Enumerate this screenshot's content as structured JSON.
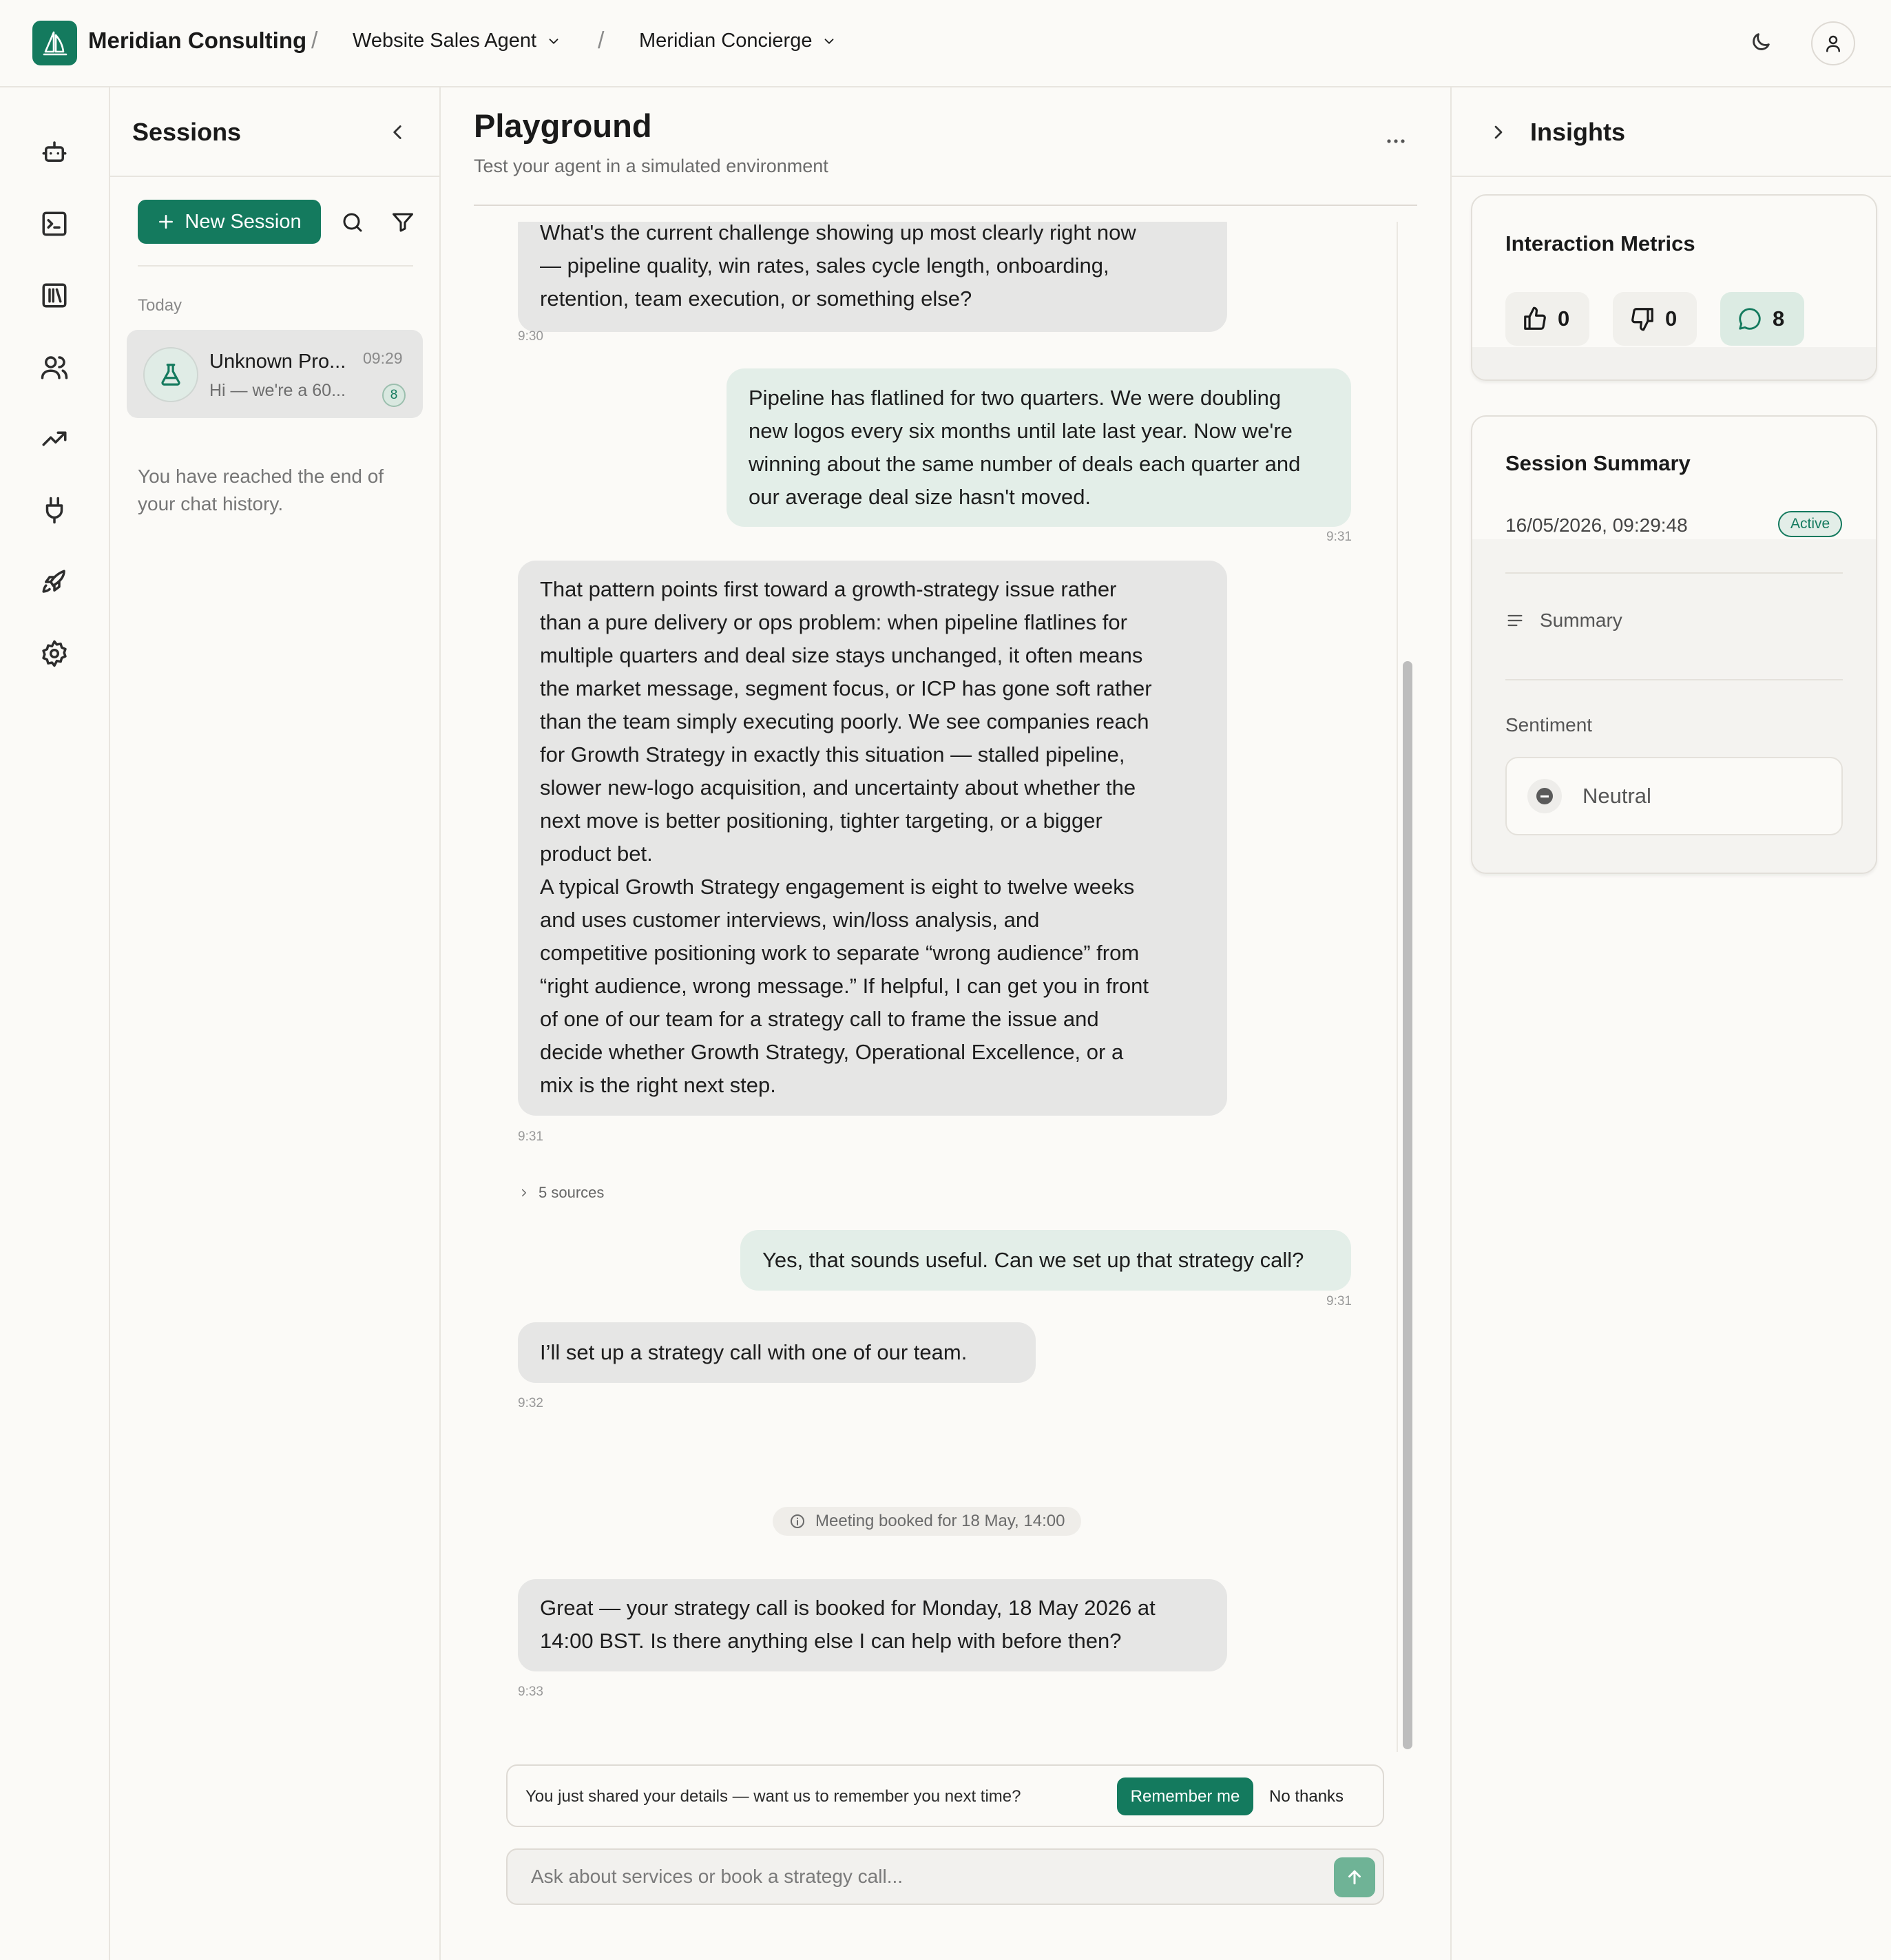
{
  "header": {
    "org_name": "Meridian Consulting",
    "separator": "/",
    "agent_selector": "Website Sales Agent",
    "persona_selector": "Meridian Concierge"
  },
  "rail": {
    "items": [
      "agents-icon",
      "terminal-icon",
      "library-icon",
      "users-icon",
      "analytics-icon",
      "integrations-icon",
      "deploy-icon",
      "settings-icon"
    ]
  },
  "sessions": {
    "title": "Sessions",
    "new_session_label": "New Session",
    "group_label": "Today",
    "items": [
      {
        "name": "Unknown Pro...",
        "time": "09:29",
        "preview": "Hi — we're a 60...",
        "count": "8"
      }
    ],
    "end_text": "You have reached the end of your chat history."
  },
  "playground": {
    "title": "Playground",
    "subtitle": "Test your agent in a simulated environment",
    "messages": [
      {
        "role": "agent",
        "lines": [
          "What's the current challenge showing up most clearly right now",
          "— pipeline quality, win rates, sales cycle length, onboarding,",
          "retention, team execution, or something else?"
        ],
        "time": "9:30"
      },
      {
        "role": "user",
        "lines": [
          "Pipeline has flatlined for two quarters. We were doubling",
          "new logos every six months until late last year. Now we're",
          "winning about the same number of deals each quarter and",
          "our average deal size hasn't moved."
        ],
        "time": "9:31"
      },
      {
        "role": "agent",
        "lines": [
          "That pattern points first toward a growth-strategy issue rather",
          "than a pure delivery or ops problem: when pipeline flatlines for",
          "multiple quarters and deal size stays unchanged, it often means",
          "the market message, segment focus, or ICP has gone soft rather",
          "than the team simply executing poorly. We see companies reach",
          "for Growth Strategy in exactly this situation — stalled pipeline,",
          "slower new-logo acquisition, and uncertainty about whether the",
          "next move is better positioning, tighter targeting, or a bigger",
          "product bet.",
          "A typical Growth Strategy engagement is eight to twelve weeks",
          "and uses customer interviews, win/loss analysis, and",
          "competitive positioning work to separate “wrong audience” from",
          "“right audience, wrong message.” If helpful, I can get you in front",
          "of one of our team for a strategy call to frame the issue and",
          "decide whether Growth Strategy, Operational Excellence, or a",
          "mix is the right next step."
        ],
        "time": "9:31"
      },
      {
        "role": "user",
        "lines": [
          "Yes, that sounds useful. Can we set up that strategy call?"
        ],
        "time": "9:31"
      },
      {
        "role": "agent",
        "lines": [
          "I’ll set up a strategy call with one of our team."
        ],
        "time": "9:32"
      },
      {
        "role": "agent",
        "lines": [
          "Great — your strategy call is booked for Monday, 18 May 2026 at",
          "14:00 BST. Is there anything else I can help with before then?"
        ],
        "time": "9:33"
      }
    ],
    "sources_label": "5 sources",
    "event_label": "Meeting booked for 18 May, 14:00",
    "remember_prompt": "You just shared your details — want us to remember you next time?",
    "remember_label": "Remember me",
    "no_thanks_label": "No thanks",
    "composer_placeholder": "Ask about services or book a strategy call..."
  },
  "insights": {
    "title": "Insights",
    "metrics_title": "Interaction Metrics",
    "likes": "0",
    "dislikes": "0",
    "messages": "8",
    "summary_title": "Session Summary",
    "summary_date": "16/05/2026, 09:29:48",
    "status": "Active",
    "summary_label": "Summary",
    "sentiment_label": "Sentiment",
    "sentiment_value": "Neutral"
  },
  "colors": {
    "brand": "#147a5e",
    "user_bubble": "#e3eee8",
    "agent_bubble": "#e6e6e5",
    "background": "#fbfaf7"
  }
}
